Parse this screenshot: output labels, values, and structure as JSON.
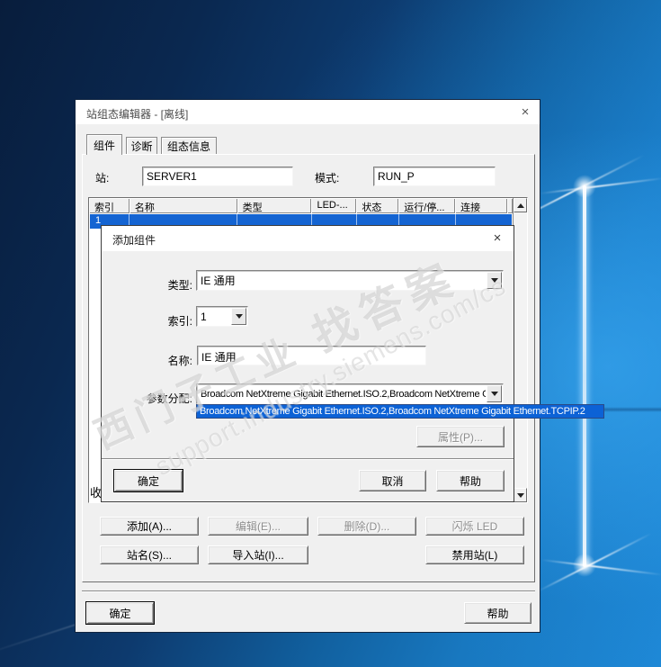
{
  "colors": {
    "selection_blue": "#1464d2",
    "dropdown_blue": "#0c62d6",
    "dialog_bg": "#f0f0f0",
    "titlebar_bg": "#ffffff",
    "desktop_accent": "#1e88d6"
  },
  "main_dialog": {
    "title": "站组态编辑器 - [离线]",
    "close_glyph": "×",
    "tabs": [
      "组件",
      "诊断",
      "组态信息"
    ],
    "fields": {
      "station_label": "站:",
      "station_value": "SERVER1",
      "mode_label": "模式:",
      "mode_value": "RUN_P"
    },
    "table": {
      "columns": [
        "索引",
        "名称",
        "类型",
        "LED-...",
        "状态",
        "运行/停...",
        "连接"
      ],
      "selected_row_index": "1"
    },
    "clipped_text": "收",
    "buttons": {
      "add": "添加(A)...",
      "edit": "编辑(E)...",
      "delete": "删除(D)...",
      "flash_led": "闪烁 LED",
      "station_name": "站名(S)...",
      "import_station": "导入站(I)...",
      "disable_station": "禁用站(L)"
    },
    "footer": {
      "ok": "确定",
      "help": "帮助"
    }
  },
  "add_dialog": {
    "title": "添加组件",
    "close_glyph": "×",
    "fields": {
      "type_label": "类型:",
      "type_value": "IE 通用",
      "index_label": "索引:",
      "index_value": "1",
      "name_label": "名称:",
      "name_value": "IE 通用",
      "param_label": "参数分配:",
      "param_value": "Broadcom NetXtreme Gigabit Ethernet.ISO.2,Broadcom NetXtreme G",
      "dropdown_item": "Broadcom NetXtreme Gigabit Ethernet.ISO.2,Broadcom NetXtreme Gigabit Ethernet.TCPIP.2"
    },
    "buttons": {
      "properties": "属性(P)...",
      "ok": "确定",
      "cancel": "取消",
      "help": "帮助"
    }
  },
  "watermark": {
    "brand": "西门子工业",
    "slogan": "找答案",
    "url": "support.industry.siemens.com/cs"
  }
}
